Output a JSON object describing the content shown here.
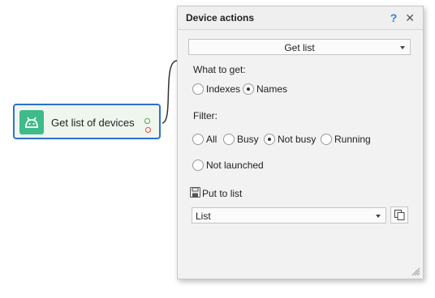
{
  "node": {
    "title": "Get list of devices"
  },
  "panel": {
    "title": "Device actions",
    "help_icon": "?",
    "close_icon": "✕",
    "action": {
      "selected": "Get list"
    },
    "what_to_get": {
      "label": "What to get:",
      "options": [
        {
          "label": "Indexes",
          "checked": false
        },
        {
          "label": "Names",
          "checked": true
        }
      ]
    },
    "filter": {
      "label": "Filter:",
      "options": [
        {
          "label": "All",
          "checked": false
        },
        {
          "label": "Busy",
          "checked": false
        },
        {
          "label": "Not busy",
          "checked": true
        },
        {
          "label": "Running",
          "checked": false
        },
        {
          "label": "Not launched",
          "checked": false
        }
      ]
    },
    "put_to_list": {
      "label": "Put to list",
      "selected": "List"
    }
  },
  "colors": {
    "node_border": "#2f6fd0",
    "node_icon_bg": "#3fba8a",
    "help_icon": "#2f7fd0",
    "port_ok": "#4aa24a",
    "port_err": "#e0483b"
  },
  "icons": [
    "android-icon",
    "help-icon",
    "close-icon",
    "save-icon",
    "copy-icon",
    "resize-grip-icon"
  ]
}
